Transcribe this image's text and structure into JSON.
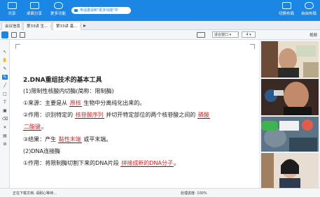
{
  "topbar": {
    "buttons": [
      {
        "label": "共享",
        "icon": "share-icon"
      },
      {
        "label": "桌面分享",
        "icon": "desktop-share-icon"
      },
      {
        "label": "更多功能",
        "icon": "more-icon"
      }
    ],
    "speaker_text": "电话邀请和\"更多功能\"中",
    "right_buttons": [
      {
        "label": "切换布局",
        "icon": "layout-icon"
      },
      {
        "label": "自由布局",
        "icon": "free-layout-icon"
      }
    ]
  },
  "tabs": [
    {
      "label": "会议信息"
    },
    {
      "label": "第33讲 生..."
    },
    {
      "label": "第33讲 基..."
    }
  ],
  "toolbar": {
    "zoom": "适合窗口",
    "page_current": "4",
    "page_sep": "/"
  },
  "sidebar": {
    "tab_label": "视频"
  },
  "document": {
    "heading": "2.DNA重组技术的基本工具",
    "s1": "(1)限制性核酸内切酶(简称：限制酶)",
    "l1_pre": "①来源：主要是从",
    "l1_blank": "原核",
    "l1_post": "生物中分离纯化出来的。",
    "l2_pre": "②作用：识别特定的",
    "l2_blank": "核苷酸序列",
    "l2_post": "并切开特定部位的两个核苷酸之间的",
    "l2_blank2a": "磷酸",
    "l2_blank2b": "二酯键",
    "l2_end": "。",
    "l3_pre": "③结果：产生",
    "l3_blank": "黏性末端",
    "l3_post": "或平末端。",
    "s2": "(2)DNA连接酶",
    "l4_pre": "①作用：将限制酶切割下来的DNA片段",
    "l4_blank": "拼接成新的DNA分子",
    "l4_end": "。"
  },
  "status": {
    "left": "正在下载文档, 请耐心等待...",
    "right": "处理进度: 100%"
  },
  "colors": {
    "accent": "#1b86e3",
    "answer_red": "#c62828"
  }
}
